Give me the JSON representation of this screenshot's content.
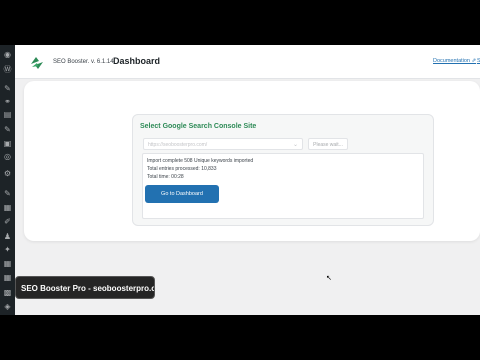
{
  "header": {
    "brand": "SEO Booster. v. 6.1.14",
    "title": "Dashboard",
    "documentation_link": "Documentation ⇗",
    "second_link": "S"
  },
  "panel": {
    "title": "Select Google Search Console Site",
    "site_select_value": "https://seoboosterpro.com/",
    "wait_button": "Please wait...",
    "log_lines": [
      "Import complete 508 Unique keywords imported",
      "Total entries processed: 10,833",
      "Total time: 00:28"
    ],
    "go_button": "Go to Dashboard"
  },
  "caption": "SEO Booster Pro - seoboosterpro.com",
  "sidebar_icons": [
    "dashboard-icon",
    "wordpress-icon",
    "pin-icon",
    "links-icon",
    "pages-icon",
    "pin2-icon",
    "lock-icon",
    "compass-icon",
    "settings-icon",
    "pin3-icon",
    "table-icon",
    "edit-icon",
    "user-icon",
    "tools-icon",
    "grid-icon",
    "grid2-icon",
    "grid3-icon",
    "shield-icon"
  ],
  "colors": {
    "accent_green": "#2e8b57",
    "button_blue": "#2271b1",
    "sidebar": "#1d2327"
  }
}
